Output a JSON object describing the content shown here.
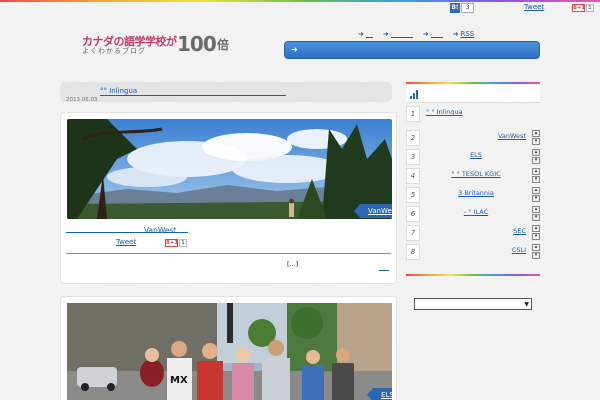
{
  "social": {
    "hatena_logo": "B!",
    "hatena_count": "3",
    "tweet_label": "Tweet",
    "gplus_label": "8+1",
    "gplus_count": "1"
  },
  "header": {
    "logo_title": "カナダの語学学校が",
    "logo_subtitle": "よくわかるブログ",
    "logo_number": "100",
    "logo_suffix": "倍",
    "nav": [
      {
        "label": ""
      },
      {
        "label": ""
      },
      {
        "label": ""
      },
      {
        "label": "RSS"
      }
    ],
    "search": {
      "value": ""
    }
  },
  "posts": [
    {
      "title": "°° Inlingua",
      "date": "2013.06.03",
      "school": "VanWest",
      "category": "VanWest",
      "tweet": "Tweet",
      "gplus": "8+1",
      "gplus_count": "1",
      "excerpt": "[...]"
    },
    {
      "category": "ELS"
    }
  ],
  "sidebar": {
    "ranking": [
      {
        "num": "1",
        "title": "° ° Inlingua"
      },
      {
        "num": "2",
        "title": "VanWest"
      },
      {
        "num": "3",
        "title": "ELS"
      },
      {
        "num": "4",
        "title": "° ° TESOL KGIC"
      },
      {
        "num": "5",
        "title": "3 Britannia"
      },
      {
        "num": "6",
        "title": "- ° ILAC"
      },
      {
        "num": "7",
        "title": "SEC"
      },
      {
        "num": "8",
        "title": "CSLI"
      }
    ],
    "select_value": ""
  },
  "colors": {
    "accent": "#2a66b2",
    "link": "#1a5fa8",
    "logo_pink": "#c03c6a"
  },
  "icons": [
    "arrow-right-icon",
    "bar-chart-icon",
    "hatena-bookmark-icon",
    "google-plus-icon",
    "chevron-down-icon"
  ]
}
